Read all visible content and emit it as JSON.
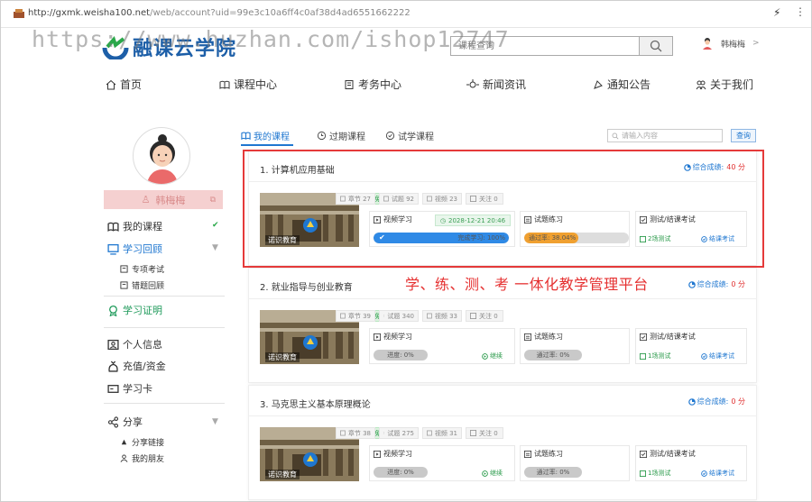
{
  "browser": {
    "url_main": "http://gxmk.weisha100.net",
    "url_rest": "/web/account?uid=99e3c10a6ff4c0af38d4ad6551662222"
  },
  "watermark": "https://www.huzhan.com/ishop12747",
  "header": {
    "logo_text": "融课云学院",
    "search_placeholder": "课程查询",
    "user_name": "韩梅梅",
    "user_chevron": ">"
  },
  "nav": [
    {
      "label": "首页",
      "icon": "home-icon"
    },
    {
      "label": "课程中心",
      "icon": "book-icon"
    },
    {
      "label": "考务中心",
      "icon": "exam-icon"
    },
    {
      "label": "新闻资讯",
      "icon": "news-icon"
    },
    {
      "label": "通知公告",
      "icon": "notice-icon"
    },
    {
      "label": "关于我们",
      "icon": "about-icon"
    }
  ],
  "sidebar": {
    "user_name": "韩梅梅",
    "items": [
      {
        "label": "我的课程",
        "icon": "book-icon"
      },
      {
        "label": "学习回顾",
        "icon": "review-icon"
      },
      {
        "label": "专项考试",
        "icon": "doc-icon"
      },
      {
        "label": "错题回顾",
        "icon": "doc-icon"
      },
      {
        "label": "学习证明",
        "icon": "certificate-icon"
      },
      {
        "label": "个人信息",
        "icon": "id-card-icon"
      },
      {
        "label": "充值/资金",
        "icon": "money-icon"
      },
      {
        "label": "学习卡",
        "icon": "card-icon"
      },
      {
        "label": "分享",
        "icon": "share-icon"
      },
      {
        "label": "分享链接",
        "icon": "link-icon"
      },
      {
        "label": "我的朋友",
        "icon": "friends-icon"
      }
    ]
  },
  "tabs": {
    "items": [
      "我的课程",
      "过期课程",
      "试学课程"
    ],
    "search_placeholder": "请输入内容",
    "search_button": "查询"
  },
  "courses": [
    {
      "title": "1. 计算机应用基础",
      "score_label": "综合成绩:",
      "score_value": "40 分",
      "thumb_caption": "诺识教育",
      "free": "免费",
      "stats": [
        "章节 27",
        "试题 92",
        "视频 23",
        "关注 0"
      ],
      "video_label": "视频学习",
      "video_date": "2028-12-21 20:46",
      "video_progress_label": "完成学习: 100%",
      "video_progress": 1.0,
      "practice_label": "试题练习",
      "practice_progress_label": "通过率: 38.04%",
      "practice_progress": 0.3804,
      "exam_label": "测试/结课考试",
      "exam_count": "2场测试",
      "exam_action": "结课考试"
    },
    {
      "title": "2. 就业指导与创业教育",
      "score_label": "综合成绩:",
      "score_value": "0 分",
      "thumb_caption": "诺识教育",
      "free": "免费",
      "stats": [
        "章节 39",
        "试题 340",
        "视频 33",
        "关注 0"
      ],
      "video_label": "视频学习",
      "video_progress_label": "进度: 0%",
      "video_progress": 0,
      "video_continue": "继续",
      "practice_label": "试题练习",
      "practice_progress_label": "通过率: 0%",
      "practice_progress": 0,
      "exam_label": "测试/结课考试",
      "exam_count": "1场测试",
      "exam_action": "结课考试"
    },
    {
      "title": "3. 马克思主义基本原理概论",
      "score_label": "综合成绩:",
      "score_value": "0 分",
      "thumb_caption": "诺识教育",
      "free": "免费",
      "stats": [
        "章节 38",
        "试题 275",
        "视频 31",
        "关注 0"
      ],
      "video_label": "视频学习",
      "video_progress_label": "进度: 0%",
      "video_progress": 0,
      "video_continue": "继续",
      "practice_label": "试题练习",
      "practice_progress_label": "通过率: 0%",
      "practice_progress": 0,
      "exam_label": "测试/结课考试",
      "exam_count": "1场测试",
      "exam_action": "结课考试"
    }
  ],
  "slogan": "学、练、测、考 一体化教学管理平台",
  "colors": {
    "accent": "#1f77d0",
    "green": "#2a9a4a",
    "red": "#e53a3a",
    "orange": "#f0a030"
  }
}
